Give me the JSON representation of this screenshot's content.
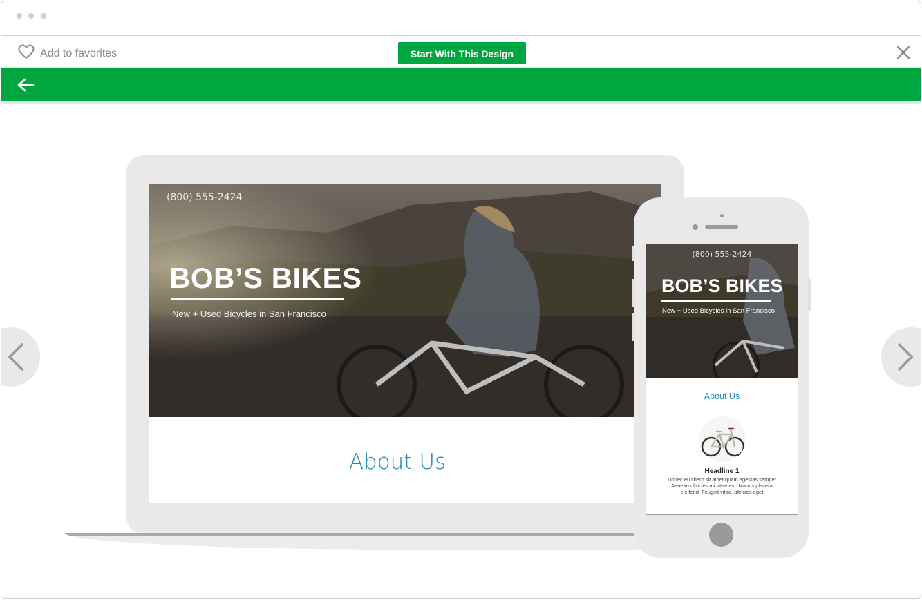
{
  "toolbar": {
    "favorites_label": "Add to favorites",
    "start_button": "Start With This Design"
  },
  "colors": {
    "brand_green": "#00a63f",
    "accent_blue": "#1f8cb0"
  },
  "icons": [
    "heart-icon",
    "close-icon",
    "back-arrow-icon",
    "chevron-left-icon",
    "chevron-right-icon"
  ],
  "laptop_preview": {
    "phone": "(800) 555-2424",
    "title": "BOB’S BIKES",
    "subtitle": "New + Used Bicycles in San Francisco",
    "about_heading": "About Us"
  },
  "mobile_preview": {
    "phone": "(800) 555-2424",
    "title": "BOB’S BIKES",
    "subtitle": "New + Used Bicycles in San Francisco",
    "about_heading": "About Us",
    "headline": "Headline 1",
    "body": "Donec eu libero sit amet quam egestas semper. Aenean ultricies mi vitae est. Mauris placerat eleifend. Feugiat vitae, ultricies eget."
  }
}
